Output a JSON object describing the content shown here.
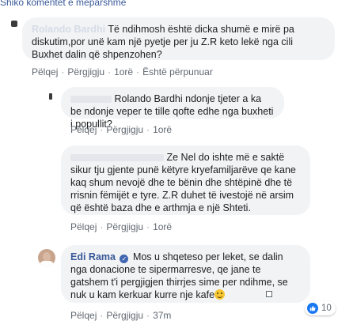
{
  "thread": {
    "see_previous": "Shiko komentet e mëparshme"
  },
  "comments": [
    {
      "author": "Rolando Bardhi",
      "text": "Të ndihmosh është dicka shumë e mirë pa diskutim,por unë kam një pyetje per ju Z.R keto lekë nga cili Buxhet dalin që shpenzohen?",
      "actions": {
        "like": "Pëlqej",
        "reply": "Përgjigju",
        "time": "1orë",
        "edited": "Është përpunuar"
      }
    },
    {
      "author": "",
      "text": "Rolando Bardhi ndonje tjeter a ka be ndonje veper te tille qofte edhe nga buxheti i popullit?",
      "actions": {
        "like": "Pëlqej",
        "reply": "Përgjigju",
        "time": "1orë"
      }
    },
    {
      "author": "",
      "text": "Ze Nel do ishte më e saktë sikur tju gjente punë këtyre kryefamiljarëve qe kane kaq shum nevojë dhe te bënin dhe shtëpinë dhe të rrisnin fëmijët e tyre. Z.R duhet të ivestojë në arsim që është baza dhe e arthmja e një Shteti.",
      "actions": {
        "like": "Pëlqej",
        "reply": "Përgjigju",
        "time": "1orë"
      }
    },
    {
      "author": "Edi Rama",
      "text": "Mos u shqeteso per leket, se dalin nga donacione te sipermarresve, qe jane te gatshem t'i pergjigjen thirrjes sime per ndihme, se nuk u kam kerkuar kurre nje kafe",
      "actions": {
        "like": "Pëlqej",
        "reply": "Përgjigju",
        "time": "37m"
      },
      "reactions": {
        "count": "10"
      }
    }
  ],
  "colors": {
    "link": "#385898",
    "bubble": "#f2f3f5",
    "like_blue": "#1877f2",
    "verified": "#4267b2"
  }
}
